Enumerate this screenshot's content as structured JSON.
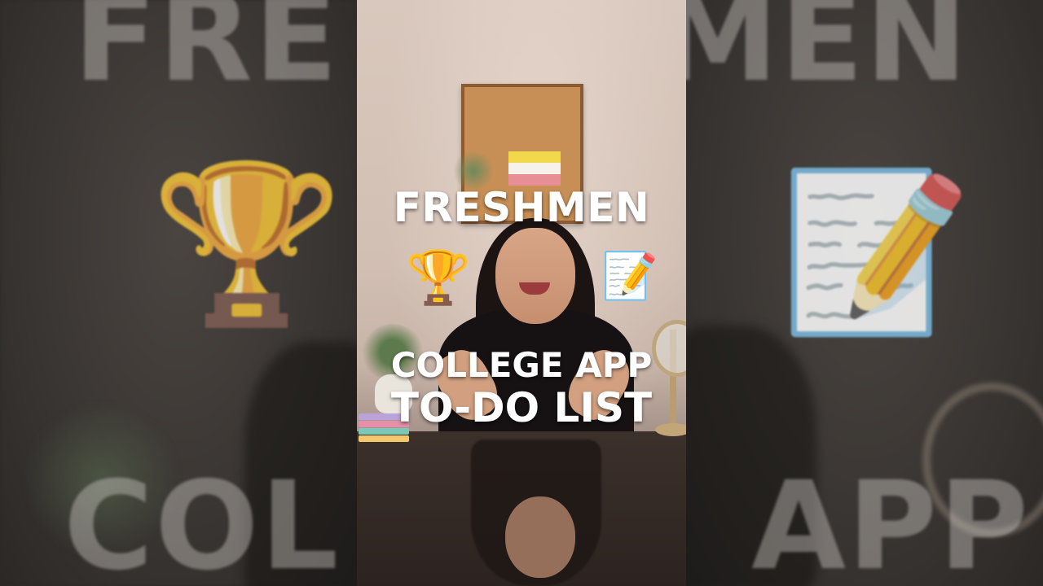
{
  "overlay": {
    "title": "FRESHMEN",
    "subtitle_line1": "COLLEGE APP",
    "subtitle_line2": "TO-DO LIST"
  },
  "background": {
    "left_top_text": "FRE",
    "right_top_text": "FRESHMEN",
    "left_bottom_text": "COL",
    "right_bottom_text": "APP"
  },
  "icons": {
    "trophy": "🏆",
    "memo": "📝"
  },
  "colors": {
    "notebook_stripes": [
      "#f2d84b",
      "#f6f1ea",
      "#e88f95"
    ],
    "sticky_notes": [
      "#b9a3d9",
      "#e58faa",
      "#7cc7b8",
      "#f3c86b"
    ]
  }
}
